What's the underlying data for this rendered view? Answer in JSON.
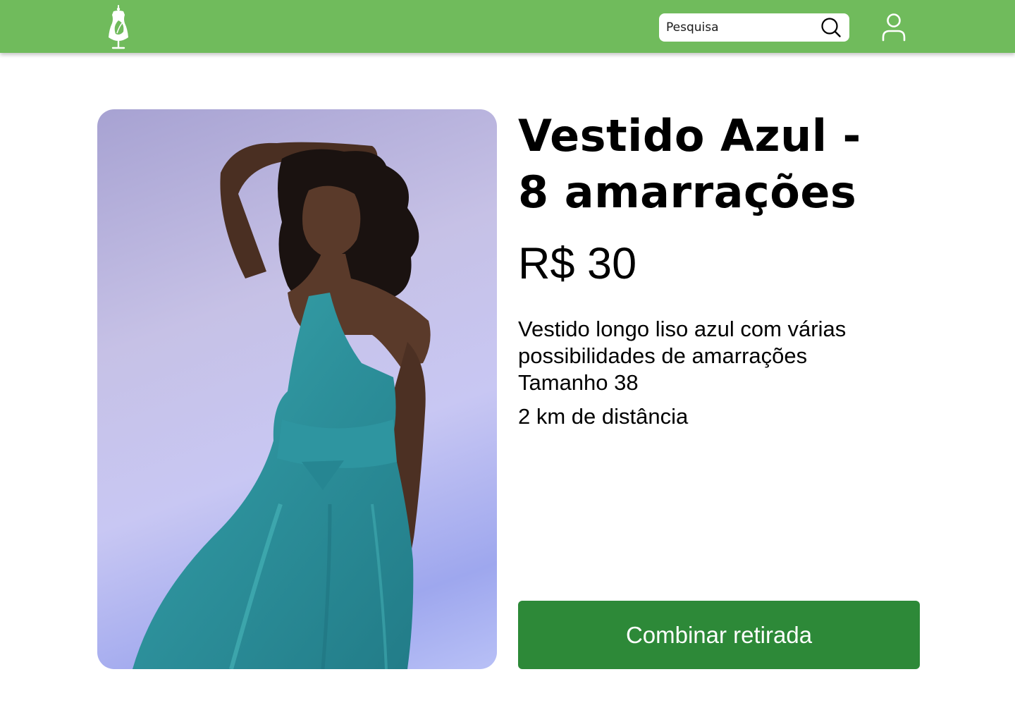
{
  "header": {
    "logo_icon": "dress-form-leaf-icon",
    "search": {
      "placeholder": "Pesquisa",
      "value": "",
      "icon": "search-icon"
    },
    "profile_icon": "user-icon",
    "background_color": "#70bb5c"
  },
  "product": {
    "image_icon": "product-photo",
    "title_lines": [
      "Vestido Azul -",
      "8 amarrações"
    ],
    "price": "R$ 30",
    "description_lines": [
      "Vestido longo liso azul com várias",
      "possibilidades de amarrações",
      "Tamanho 38"
    ],
    "distance": "2 km de distância",
    "cta_label": "Combinar retirada",
    "cta_color": "#2d8938"
  }
}
